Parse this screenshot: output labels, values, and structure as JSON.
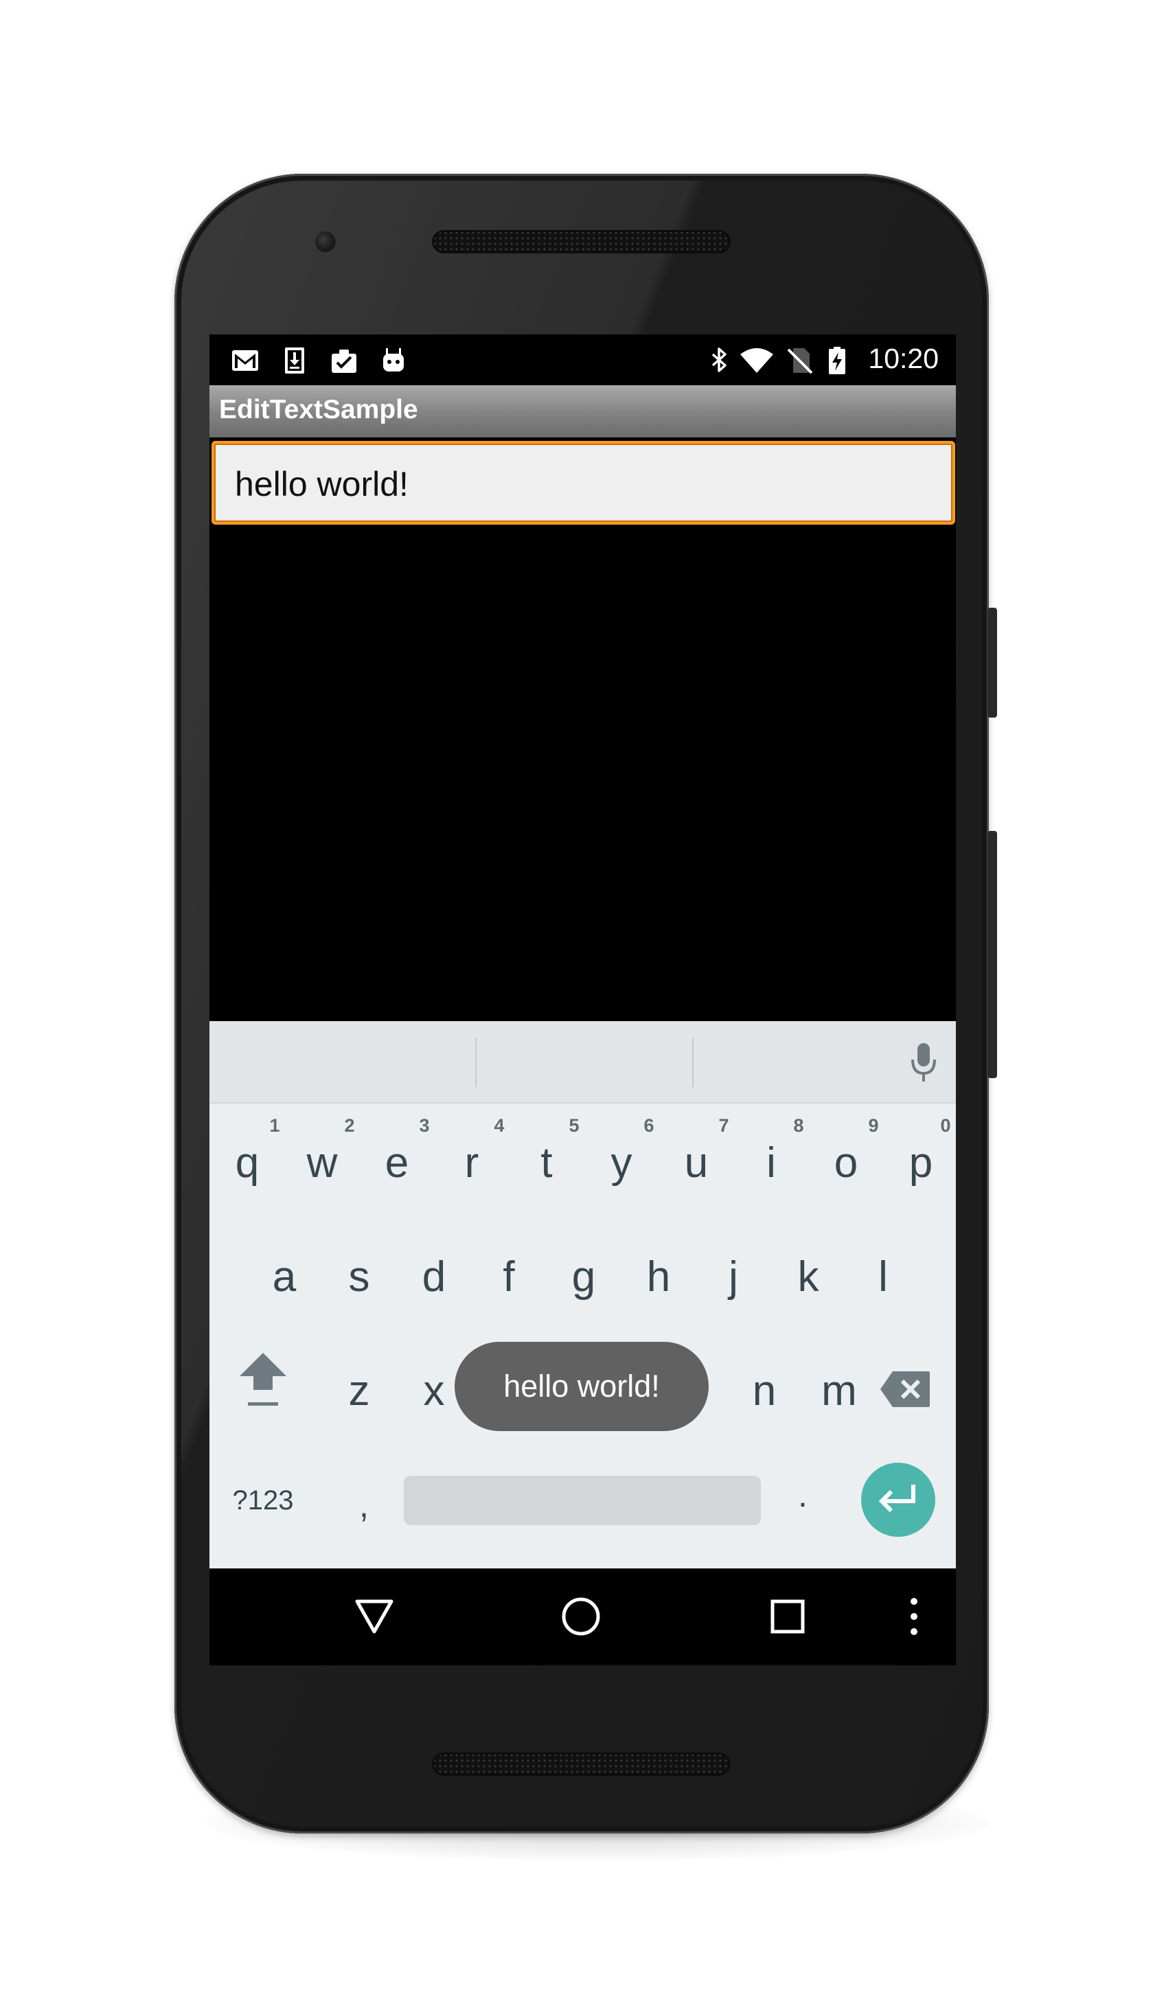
{
  "status_bar": {
    "time": "10:20",
    "left_icons": [
      "gmail-icon",
      "download-icon",
      "clipboard-check-icon",
      "android-icon"
    ],
    "right_icons": [
      "bluetooth-icon",
      "wifi-icon",
      "no-sim-icon",
      "battery-charging-icon"
    ]
  },
  "app": {
    "title": "EditTextSample",
    "edit_text_value": "hello world!"
  },
  "keyboard": {
    "row1": [
      {
        "key": "q",
        "hint": "1"
      },
      {
        "key": "w",
        "hint": "2"
      },
      {
        "key": "e",
        "hint": "3"
      },
      {
        "key": "r",
        "hint": "4"
      },
      {
        "key": "t",
        "hint": "5"
      },
      {
        "key": "y",
        "hint": "6"
      },
      {
        "key": "u",
        "hint": "7"
      },
      {
        "key": "i",
        "hint": "8"
      },
      {
        "key": "o",
        "hint": "9"
      },
      {
        "key": "p",
        "hint": "0"
      }
    ],
    "row2": [
      "a",
      "s",
      "d",
      "f",
      "g",
      "h",
      "j",
      "k",
      "l"
    ],
    "row3": [
      "z",
      "x",
      "n",
      "m"
    ],
    "symbols_label": "?123",
    "comma": ",",
    "period": ".",
    "key_preview_text": "hello world!",
    "suggestion_icons": [
      "mic-icon"
    ],
    "accent_color": "#4db6ac"
  },
  "colors": {
    "edit_border": "#ff9a1f",
    "title_bar": "#858585"
  }
}
